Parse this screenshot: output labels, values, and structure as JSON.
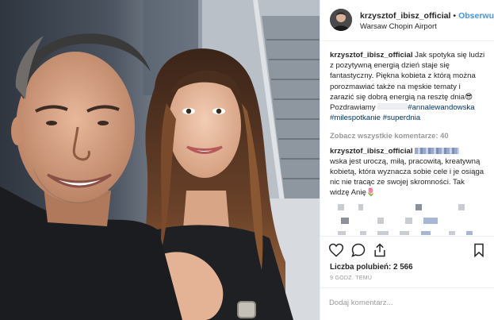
{
  "post": {
    "username": "krzysztof_ibisz_official",
    "separator": "•",
    "follow_label": "Obserwuj",
    "location": "Warsaw Chopin Airport"
  },
  "caption": {
    "username": "krzysztof_ibisz_official",
    "text": "Jak spotyka się ludzi z pozytywną energią dzień staje się fantastyczny. Piękna kobieta z którą można porozmawiać także na męskie tematy i zarazić się dobrą energią na resztę dnia😎 Pozdrawiamy",
    "hashtags": [
      "#annalewandowska",
      "#milespotkanie",
      "#superdnia"
    ]
  },
  "view_all_comments": "Zobacz wszystkie komentarze: 40",
  "comment": {
    "username": "krzysztof_ibisz_official",
    "text": "wska jest uroczą, miłą, pracowitą, kreatywną kobietą, która wyznacza sobie cele i je osiąga nic nie tracąc ze swojej skromności. Tak widzę Anię🌷"
  },
  "likes": {
    "label": "Liczba polubień:",
    "count": "2 566"
  },
  "time_ago": "9 GODZ. TEMU",
  "add_comment_placeholder": "Dodaj komentarz...",
  "icons": {
    "like": "heart-icon",
    "comment": "comment-icon",
    "share": "share-icon",
    "save": "bookmark-icon"
  },
  "colors": {
    "link_blue": "#3897f0",
    "hashtag": "#003569",
    "muted": "#999999",
    "text": "#262626"
  }
}
